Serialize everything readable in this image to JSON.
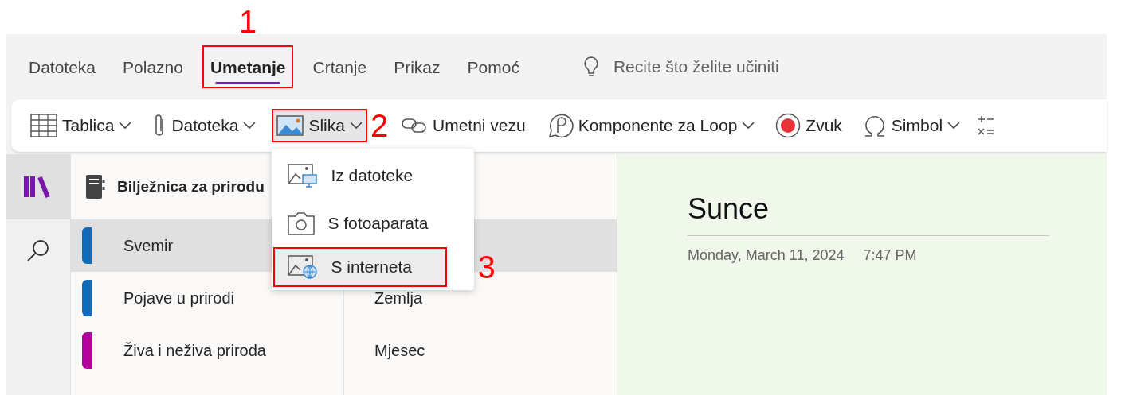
{
  "menu_tabs": [
    {
      "label": "Datoteka",
      "selected": false
    },
    {
      "label": "Polazno",
      "selected": false
    },
    {
      "label": "Umetanje",
      "selected": true,
      "callout": "1"
    },
    {
      "label": "Crtanje",
      "selected": false
    },
    {
      "label": "Prikaz",
      "selected": false
    },
    {
      "label": "Pomoć",
      "selected": false
    }
  ],
  "tell_me": {
    "placeholder": "Recite što želite učiniti"
  },
  "ribbon": [
    {
      "label": "Tablica",
      "has_menu": true,
      "pressed": false
    },
    {
      "label": "Datoteka",
      "has_menu": true,
      "pressed": false
    },
    {
      "label": "Slika",
      "has_menu": true,
      "pressed": true,
      "callout": "2"
    },
    {
      "label": "Umetni vezu",
      "has_menu": false,
      "pressed": false
    },
    {
      "label": "Komponente za Loop",
      "has_menu": true,
      "pressed": false
    },
    {
      "label": "Zvuk",
      "has_menu": false,
      "pressed": false
    },
    {
      "label": "Simbol",
      "has_menu": true,
      "pressed": false
    }
  ],
  "picture_menu": [
    {
      "label": "Iz datoteke",
      "selected": false
    },
    {
      "label": "S fotoaparata",
      "selected": false
    },
    {
      "label": "S interneta",
      "selected": true,
      "callout": "3"
    }
  ],
  "notebook": {
    "title": "Bilježnica za prirodu"
  },
  "sections": [
    {
      "label": "Svemir",
      "selected": true,
      "color": "#0f6cbd"
    },
    {
      "label": "Pojave u prirodi",
      "selected": false,
      "color": "#0f6cbd"
    },
    {
      "label": "Živa i neživa priroda",
      "selected": false,
      "color": "#b4009e"
    }
  ],
  "pages": [
    {
      "label": "Zemlja"
    },
    {
      "label": "Mjesec"
    }
  ],
  "page": {
    "title": "Sunce",
    "date": "Monday, March 11, 2024",
    "time": "7:47 PM"
  }
}
